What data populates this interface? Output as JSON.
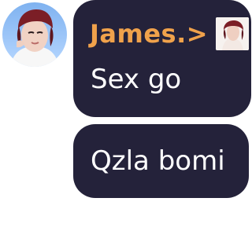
{
  "chat": {
    "avatar_icon": "user-avatar-icon",
    "messages": [
      {
        "sender": "James.>",
        "text": "Sex go",
        "sender_avatar_icon": "sender-thumbnail-icon"
      },
      {
        "text": "Qzla bomi"
      }
    ]
  },
  "colors": {
    "bubble_background": "#24223a",
    "sender_name": "#f0a24b",
    "message_text": "#ffffff",
    "page_background": "#ffffff"
  }
}
